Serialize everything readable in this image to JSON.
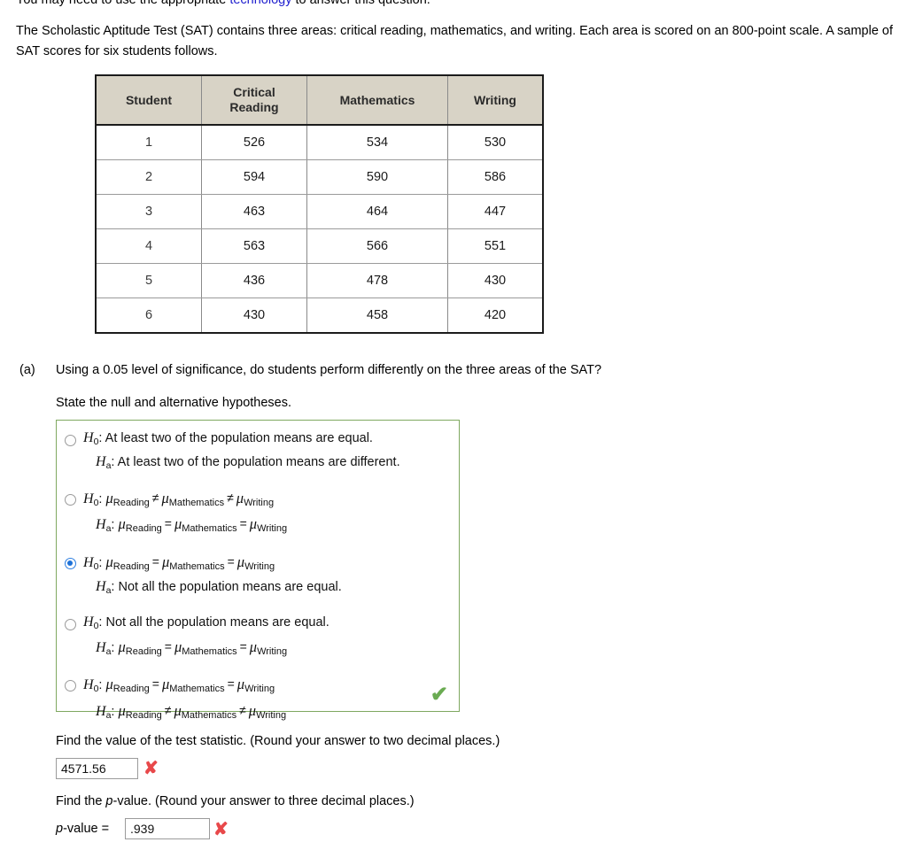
{
  "header": {
    "clipped_notice_before": "You may need to use the appropriate ",
    "clipped_notice_link": "technology",
    "clipped_notice_after": " to answer this question."
  },
  "intro": {
    "paragraph": "The Scholastic Aptitude Test (SAT) contains three areas: critical reading, mathematics, and writing. Each area is scored on an 800-point scale. A sample of SAT scores for six students follows."
  },
  "table": {
    "headers": [
      "Student",
      "Critical\nReading",
      "Mathematics",
      "Writing"
    ],
    "rows": [
      [
        "1",
        "526",
        "534",
        "530"
      ],
      [
        "2",
        "594",
        "590",
        "586"
      ],
      [
        "3",
        "463",
        "464",
        "447"
      ],
      [
        "4",
        "563",
        "566",
        "551"
      ],
      [
        "5",
        "436",
        "478",
        "430"
      ],
      [
        "6",
        "430",
        "458",
        "420"
      ]
    ]
  },
  "part_a": {
    "label": "(a)",
    "question": "Using a 0.05 level of significance, do students perform differently on the three areas of the SAT?",
    "state_hypotheses": "State the null and alternative hypotheses.",
    "options": [
      {
        "selected": false,
        "null_text": "At least two of the population means are equal.",
        "alt_text": "At least two of the population means are different.",
        "null_kind": "text",
        "alt_kind": "text"
      },
      {
        "selected": false,
        "null_kind": "mu",
        "null_rel1": "≠",
        "null_rel2": "≠",
        "alt_kind": "mu",
        "alt_rel1": "=",
        "alt_rel2": "="
      },
      {
        "selected": true,
        "null_kind": "mu",
        "null_rel1": "=",
        "null_rel2": "=",
        "alt_kind": "text",
        "alt_text": "Not all the population means are equal."
      },
      {
        "selected": false,
        "null_kind": "text",
        "null_text": "Not all the population means are equal.",
        "alt_kind": "mu",
        "alt_rel1": "=",
        "alt_rel2": "="
      },
      {
        "selected": false,
        "null_kind": "mu",
        "null_rel1": "=",
        "null_rel2": "=",
        "alt_kind": "mu",
        "alt_rel1": "≠",
        "alt_rel2": "≠"
      }
    ],
    "subscripts": {
      "h_null": "0",
      "h_alt": "a",
      "mu1": "Reading",
      "mu2": "Mathematics",
      "mu3": "Writing"
    },
    "feedback_icon": "check-mark-correct",
    "feedback_glyph": "✔"
  },
  "test_statistic": {
    "prompt_before": "Find the value of the test statistic. (Round your answer to two decimal places.)",
    "value": "4571.56",
    "feedback_icon": "x-mark-incorrect",
    "feedback_glyph": "✘"
  },
  "p_value": {
    "prompt_before": "Find the ",
    "prompt_italic": "p",
    "prompt_after": "-value. (Round your answer to three decimal places.)",
    "label_italic": "p",
    "label_after": "-value =",
    "value": ".939",
    "feedback_icon": "x-mark-incorrect",
    "feedback_glyph": "✘"
  },
  "colors": {
    "link": "#2020cf",
    "table_header_bg": "#d8d3c6",
    "answer_box_border": "#7fa860",
    "correct_green": "#6aab52",
    "incorrect_red": "#e8484a",
    "radio_selected": "#1e72d8"
  }
}
